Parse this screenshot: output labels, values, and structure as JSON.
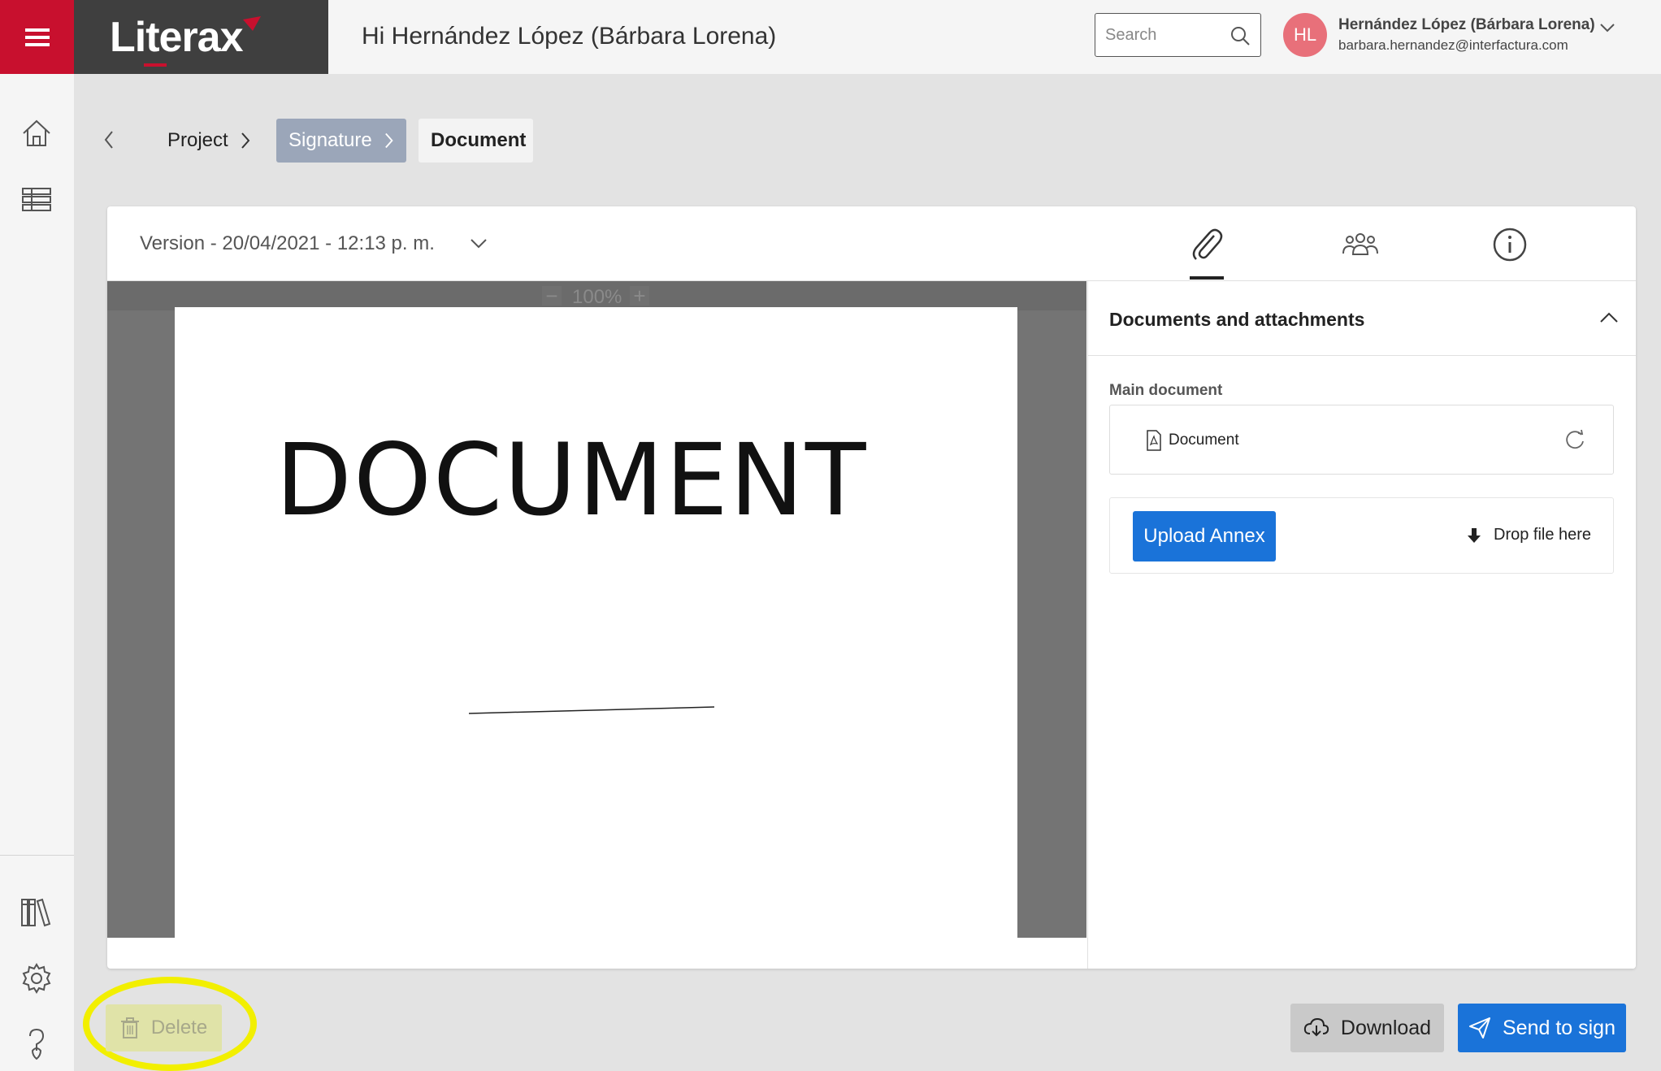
{
  "header": {
    "logo_text": "Literax",
    "greeting": "Hi Hernández López (Bárbara Lorena)",
    "search_placeholder": "Search",
    "user": {
      "initials": "HL",
      "name": "Hernández López (Bárbara Lorena)",
      "email": "barbara.hernandez@interfactura.com"
    }
  },
  "sidebar": {
    "top_items": [
      "home-icon",
      "table-icon"
    ],
    "bottom_items": [
      "library-icon",
      "settings-icon",
      "help-icon"
    ]
  },
  "breadcrumb": {
    "items": [
      {
        "label": "Project"
      },
      {
        "label": "Signature"
      },
      {
        "label": "Document"
      }
    ]
  },
  "card": {
    "version_label": "Version - 20/04/2021 - 12:13 p. m.",
    "tabs": [
      "paperclip-icon",
      "users-icon",
      "info-icon"
    ],
    "active_tab": "paperclip-icon"
  },
  "viewer": {
    "zoom": "100%",
    "page_title": "DOCUMENT"
  },
  "panel": {
    "title": "Documents and attachments",
    "main_document_label": "Main document",
    "document_name": "Document",
    "upload_label": "Upload Annex",
    "drop_label": "Drop file here"
  },
  "actions": {
    "delete_label": "Delete",
    "download_label": "Download",
    "send_label": "Send to sign"
  },
  "colors": {
    "brand_red": "#c8102e",
    "primary_blue": "#1a73d9",
    "highlight_yellow": "#f2ef00",
    "breadcrumb_active": "#9ba6b9"
  }
}
